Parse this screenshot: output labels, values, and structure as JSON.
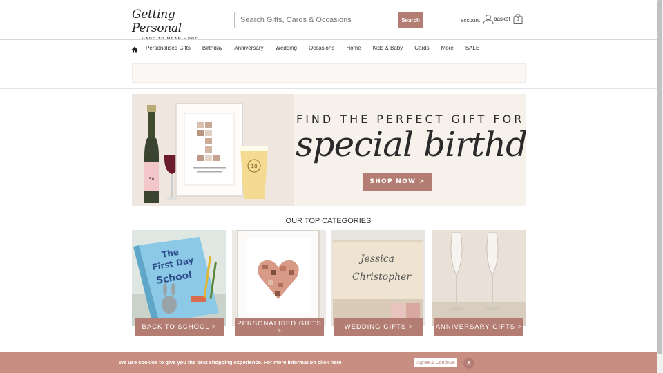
{
  "header": {
    "logo_script": "Getting Personal",
    "logo_tagline": "MADE TO MEAN MORE",
    "search_placeholder": "Search Gifts, Cards & Occasions",
    "search_button": "Search",
    "account_label": "account",
    "basket_label": "basket",
    "basket_count": "0"
  },
  "nav": {
    "items": [
      "Personalised Gifts",
      "Birthday",
      "Anniversary",
      "Wedding",
      "Occasions",
      "Home",
      "Kids & Baby",
      "Cards",
      "More",
      "SALE"
    ]
  },
  "hero": {
    "headline": "FIND THE PERFECT GIFT FOR A",
    "script": "special birthday",
    "cta": "SHOP NOW >"
  },
  "categories": {
    "title": "OUR TOP CATEGORIES",
    "items": [
      {
        "label": "BACK TO SCHOOL >",
        "image": "first-day-at-school-book"
      },
      {
        "label": "PERSONALISED GIFTS >",
        "image": "photo-heart-collage-frame"
      },
      {
        "label": "WEDDING GIFTS >",
        "image": "engraved-wooden-keepsake-box"
      },
      {
        "label": "ANNIVERSARY GIFTS >",
        "image": "engraved-champagne-flutes"
      }
    ]
  },
  "cookie": {
    "message": "We use cookies to give you the best shopping experience. For more information click",
    "link": "here",
    "accept": "Agree & Continue",
    "close": "X"
  },
  "colors": {
    "brand": "#b37d73",
    "cookie_bar": "#c88e82",
    "hero_bg": "#f7f1ec"
  }
}
